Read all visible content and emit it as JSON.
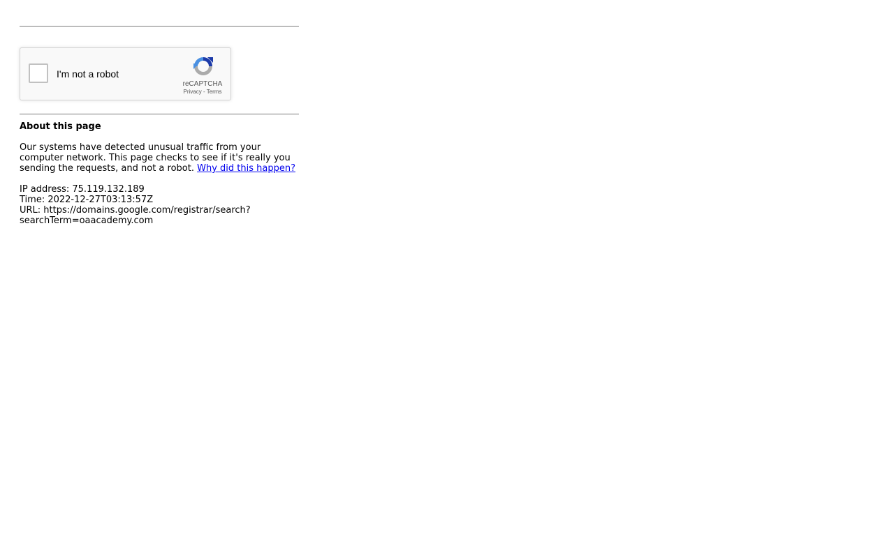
{
  "captcha": {
    "label": "I'm not a robot",
    "brand": "reCAPTCHA",
    "privacy": "Privacy",
    "separator": " - ",
    "terms": "Terms"
  },
  "about": {
    "heading": "About this page",
    "message": "Our systems have detected unusual traffic from your computer network. This page checks to see if it's really you sending the requests, and not a robot. ",
    "link": "Why did this happen?"
  },
  "details": {
    "ip": "IP address: 75.119.132.189",
    "time": "Time: 2022-12-27T03:13:57Z",
    "url_line1": "URL: https://domains.google.com/registrar/search?",
    "url_line2": "searchTerm=oaacademy.com"
  },
  "colors": {
    "link": "#0000ee",
    "logo_blue_dark": "#1c3aa9",
    "logo_blue_light": "#4a90e2",
    "logo_grey": "#ababab"
  }
}
